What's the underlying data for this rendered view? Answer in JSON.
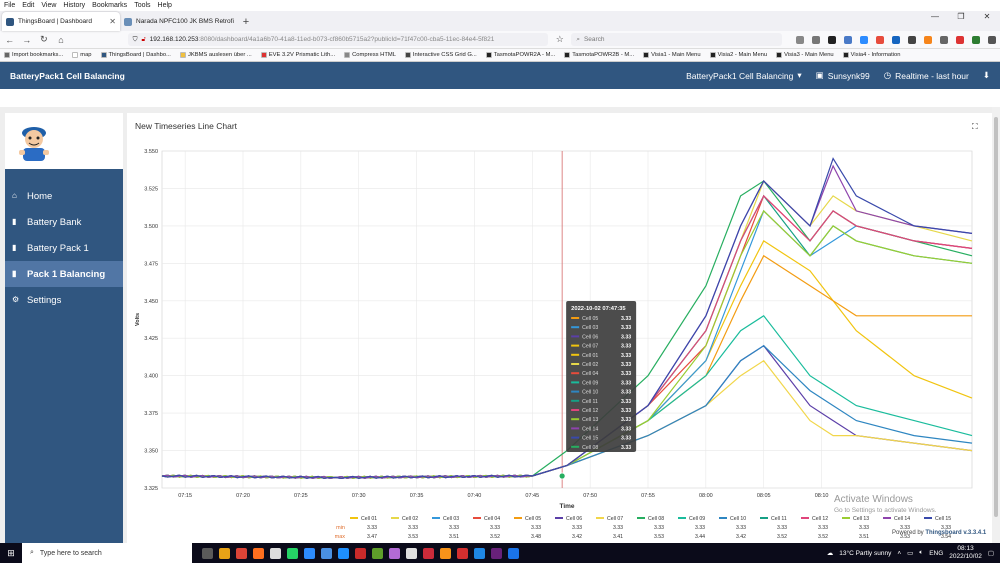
{
  "menu": [
    "File",
    "Edit",
    "View",
    "History",
    "Bookmarks",
    "Tools",
    "Help"
  ],
  "tabs": [
    {
      "label": "ThingsBoard | Dashboard",
      "active": true,
      "color": "#305680"
    },
    {
      "label": "Narada NPFC100 JK BMS Retrofi",
      "active": false,
      "color": "#6a8fb8"
    }
  ],
  "url": {
    "host": "192.168.120.253",
    "path": ":8080/dashboard/4a1a6b70-41a8-11ed-b073-cf860b5715a2?publicId=71f47c00-cba5-11ec-84e4-5f821"
  },
  "search_placeholder": "Search",
  "bookmarks": [
    {
      "label": "Import bookmarks...",
      "color": "#666"
    },
    {
      "label": "map",
      "color": "#fff"
    },
    {
      "label": "ThingsBoard | Dashbo...",
      "color": "#305680"
    },
    {
      "label": "JKBMS auslesen über ...",
      "color": "#f0c040"
    },
    {
      "label": "EVE 3.2V Prismatic Lith...",
      "color": "#d33"
    },
    {
      "label": "Compress HTML",
      "color": "#888"
    },
    {
      "label": "Interactive CSS Grid G...",
      "color": "#444"
    },
    {
      "label": "TasmotaPOWR2A - M...",
      "color": "#222"
    },
    {
      "label": "TasmotaPOWR2B - M...",
      "color": "#222"
    },
    {
      "label": "Visia1 - Main Menu",
      "color": "#222"
    },
    {
      "label": "Visia2 - Main Menu",
      "color": "#222"
    },
    {
      "label": "Visia3 - Main Menu",
      "color": "#222"
    },
    {
      "label": "Visia4 - Information",
      "color": "#222"
    }
  ],
  "header": {
    "title": "BatteryPack1 Cell Balancing",
    "state": "BatteryPack1 Cell Balancing",
    "user": "Sunsynk99",
    "timewindow": "Realtime - last hour"
  },
  "nav": [
    {
      "label": "Home",
      "icon": "home-icon",
      "glyph": "⌂",
      "active": false
    },
    {
      "label": "Battery Bank",
      "icon": "battery-icon",
      "glyph": "▮",
      "active": false
    },
    {
      "label": "Battery Pack 1",
      "icon": "battery-icon",
      "glyph": "▮",
      "active": false
    },
    {
      "label": "Pack 1 Balancing",
      "icon": "battery-icon",
      "glyph": "▮",
      "active": true
    },
    {
      "label": "Settings",
      "icon": "gear-icon",
      "glyph": "⚙",
      "active": false
    }
  ],
  "widget_title": "New Timeseries Line Chart",
  "tooltip": {
    "title": "2022-10-02 07:47:35",
    "rows": [
      {
        "name": "Cell 05",
        "value": "3.33",
        "color": "#f39c12"
      },
      {
        "name": "Cell 03",
        "value": "3.33",
        "color": "#3498db"
      },
      {
        "name": "Cell 06",
        "value": "3.33",
        "color": "#5b3fa8"
      },
      {
        "name": "Cell 07",
        "value": "3.33",
        "color": "#f1c40f"
      },
      {
        "name": "Cell 01",
        "value": "3.33",
        "color": "#f1c40f"
      },
      {
        "name": "Cell 02",
        "value": "3.33",
        "color": "#e6d84a"
      },
      {
        "name": "Cell 04",
        "value": "3.33",
        "color": "#e74c3c"
      },
      {
        "name": "Cell 09",
        "value": "3.33",
        "color": "#1abc9c"
      },
      {
        "name": "Cell 10",
        "value": "3.33",
        "color": "#2e86c1"
      },
      {
        "name": "Cell 11",
        "value": "3.33",
        "color": "#16a085"
      },
      {
        "name": "Cell 12",
        "value": "3.33",
        "color": "#e0457b"
      },
      {
        "name": "Cell 13",
        "value": "3.33",
        "color": "#9acd32"
      },
      {
        "name": "Cell 14",
        "value": "3.33",
        "color": "#8e44ad"
      },
      {
        "name": "Cell 15",
        "value": "3.33",
        "color": "#3949ab"
      },
      {
        "name": "Cell 08",
        "value": "3.33",
        "color": "#27ae60"
      }
    ]
  },
  "chart_data": {
    "type": "line",
    "title": "New Timeseries Line Chart",
    "xlabel": "Time",
    "ylabel": "Volts",
    "ylim": [
      3.325,
      3.55
    ],
    "yticks": [
      "3.325",
      "3.350",
      "3.375",
      "3.400",
      "3.425",
      "3.450",
      "3.475",
      "3.500",
      "3.525",
      "3.550"
    ],
    "xticks": [
      "07:15",
      "07:20",
      "07:25",
      "07:30",
      "07:35",
      "07:40",
      "07:45",
      "07:50",
      "07:55",
      "08:00",
      "08:05",
      "08:10"
    ],
    "x": [
      0,
      15,
      32,
      35,
      42,
      47,
      50,
      52,
      56,
      58,
      60,
      65,
      70
    ],
    "x_minutes_from": "07:13",
    "series": [
      {
        "name": "Cell 01",
        "color": "#f1c40f",
        "min": "3.33",
        "max": "3.47",
        "values": [
          3.333,
          3.332,
          3.333,
          3.34,
          3.37,
          3.41,
          3.46,
          3.49,
          3.47,
          3.45,
          3.43,
          3.4,
          3.385
        ]
      },
      {
        "name": "Cell 02",
        "color": "#e6d84a",
        "min": "3.33",
        "max": "3.53",
        "values": [
          3.333,
          3.332,
          3.333,
          3.34,
          3.38,
          3.43,
          3.49,
          3.53,
          3.5,
          3.52,
          3.51,
          3.5,
          3.49
        ]
      },
      {
        "name": "Cell 03",
        "color": "#3498db",
        "min": "3.33",
        "max": "3.51",
        "values": [
          3.333,
          3.332,
          3.333,
          3.34,
          3.37,
          3.41,
          3.47,
          3.51,
          3.48,
          3.49,
          3.5,
          3.49,
          3.485
        ]
      },
      {
        "name": "Cell 04",
        "color": "#e74c3c",
        "min": "3.33",
        "max": "3.52",
        "values": [
          3.333,
          3.332,
          3.333,
          3.34,
          3.38,
          3.42,
          3.48,
          3.52,
          3.49,
          3.51,
          3.5,
          3.49,
          3.485
        ]
      },
      {
        "name": "Cell 05",
        "color": "#f39c12",
        "min": "3.33",
        "max": "3.48",
        "values": [
          3.333,
          3.332,
          3.333,
          3.34,
          3.37,
          3.4,
          3.45,
          3.48,
          3.46,
          3.45,
          3.44,
          3.44,
          3.44
        ]
      },
      {
        "name": "Cell 06",
        "color": "#5b3fa8",
        "min": "3.33",
        "max": "3.42",
        "values": [
          3.333,
          3.332,
          3.333,
          3.34,
          3.36,
          3.38,
          3.41,
          3.42,
          3.38,
          3.37,
          3.36,
          3.355,
          3.35
        ]
      },
      {
        "name": "Cell 07",
        "color": "#f1d64a",
        "min": "3.33",
        "max": "3.41",
        "values": [
          3.333,
          3.332,
          3.333,
          3.34,
          3.36,
          3.38,
          3.4,
          3.41,
          3.37,
          3.36,
          3.36,
          3.355,
          3.35
        ]
      },
      {
        "name": "Cell 08",
        "color": "#27ae60",
        "min": "3.33",
        "max": "3.53",
        "values": [
          3.333,
          3.332,
          3.333,
          3.35,
          3.4,
          3.46,
          3.52,
          3.53,
          3.49,
          3.51,
          3.5,
          3.49,
          3.48
        ]
      },
      {
        "name": "Cell 09",
        "color": "#1abc9c",
        "min": "3.33",
        "max": "3.44",
        "values": [
          3.333,
          3.332,
          3.333,
          3.34,
          3.37,
          3.4,
          3.43,
          3.44,
          3.4,
          3.39,
          3.38,
          3.37,
          3.36
        ]
      },
      {
        "name": "Cell 10",
        "color": "#2e86c1",
        "min": "3.33",
        "max": "3.42",
        "values": [
          3.333,
          3.332,
          3.333,
          3.34,
          3.36,
          3.38,
          3.41,
          3.42,
          3.39,
          3.38,
          3.37,
          3.36,
          3.355
        ]
      },
      {
        "name": "Cell 11",
        "color": "#16a085",
        "min": "3.33",
        "max": "3.52",
        "values": [
          3.333,
          3.332,
          3.333,
          3.34,
          3.38,
          3.43,
          3.49,
          3.52,
          3.48,
          3.5,
          3.49,
          3.48,
          3.475
        ]
      },
      {
        "name": "Cell 12",
        "color": "#e0457b",
        "min": "3.33",
        "max": "3.52",
        "values": [
          3.333,
          3.332,
          3.333,
          3.34,
          3.38,
          3.43,
          3.49,
          3.52,
          3.49,
          3.51,
          3.5,
          3.49,
          3.485
        ]
      },
      {
        "name": "Cell 13",
        "color": "#9acd32",
        "min": "3.33",
        "max": "3.51",
        "values": [
          3.333,
          3.332,
          3.333,
          3.34,
          3.37,
          3.42,
          3.48,
          3.51,
          3.48,
          3.5,
          3.49,
          3.48,
          3.475
        ]
      },
      {
        "name": "Cell 14",
        "color": "#8e44ad",
        "min": "3.33",
        "max": "3.53",
        "values": [
          3.333,
          3.332,
          3.333,
          3.34,
          3.38,
          3.44,
          3.5,
          3.53,
          3.5,
          3.54,
          3.51,
          3.5,
          3.495
        ]
      },
      {
        "name": "Cell 15",
        "color": "#3949ab",
        "min": "3.33",
        "max": "3.54",
        "values": [
          3.333,
          3.332,
          3.333,
          3.34,
          3.38,
          3.44,
          3.5,
          3.53,
          3.5,
          3.545,
          3.52,
          3.5,
          3.495
        ]
      }
    ],
    "legend_row_labels": {
      "min": "min",
      "max": "max"
    },
    "marker_time": "07:47:35"
  },
  "activate": {
    "title": "Activate Windows",
    "sub": "Go to Settings to activate Windows."
  },
  "powered_by": {
    "prefix": "Powered by",
    "brand": "Thingsboard v.3.3.4.1"
  },
  "taskbar": {
    "search": "Type here to search",
    "weather": "13°C  Partly sunny",
    "lang": "ENG",
    "time": "08:13",
    "date": "2022/10/02",
    "apps": [
      "#5a5a5a",
      "#e8a317",
      "#db4437",
      "#ff6f1f",
      "#ddd",
      "#25d366",
      "#2d8cff",
      "#4a90e2",
      "#1e90ff",
      "#c92a2a",
      "#5e9e2a",
      "#b36bd6",
      "#e0e0e0",
      "#cc2b3a",
      "#f7931a",
      "#d32f2f",
      "#1e88e5",
      "#68217a",
      "#1a73e8"
    ]
  }
}
